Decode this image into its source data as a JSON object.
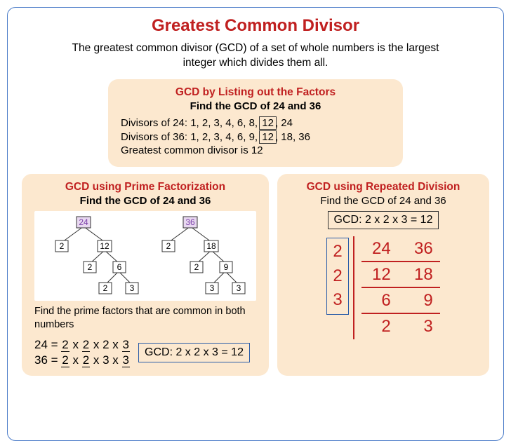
{
  "title": "Greatest Common Divisor",
  "intro": "The greatest common divisor (GCD) of a set of whole numbers is the largest integer which divides them all.",
  "listing": {
    "title": "GCD by Listing out the Factors",
    "subtitle": "Find the GCD of 24 and 36",
    "line1_prefix": "Divisors of 24: 1, 2, 3, 4, 6, 8, ",
    "line1_boxed": "12",
    "line1_suffix": ", 24",
    "line2_prefix": "Divisors of 36: 1, 2, 3, 4, 6, 9, ",
    "line2_boxed": "12",
    "line2_suffix": ", 18, 36",
    "result": "Greatest common divisor is 12"
  },
  "prime": {
    "title": "GCD using Prime Factorization",
    "subtitle": "Find the GCD of 24 and 36",
    "note": "Find the prime factors that are common in both numbers",
    "tree1": {
      "root": "24",
      "nodes": [
        "2",
        "12",
        "2",
        "6",
        "2",
        "3"
      ]
    },
    "tree2": {
      "root": "36",
      "nodes": [
        "2",
        "18",
        "2",
        "9",
        "3",
        "3"
      ]
    },
    "eq1_a": "24 = ",
    "eq1_b": "2",
    "eq1_c": " x ",
    "eq1_d": "2",
    "eq1_e": " x 2 x ",
    "eq1_f": "3",
    "eq2_a": "36 = ",
    "eq2_b": "2",
    "eq2_c": " x ",
    "eq2_d": "2",
    "eq2_e": " x 3 x ",
    "eq2_f": "3",
    "gcd_box": "GCD: 2 x 2 x 3 = 12"
  },
  "repeated": {
    "title": "GCD using Repeated Division",
    "subtitle": "Find the GCD of 24 and 36",
    "gcd_box": "GCD: 2 x 2 x 3 = 12",
    "divisors": [
      "2",
      "2",
      "3"
    ],
    "rows": [
      [
        "24",
        "36"
      ],
      [
        "12",
        "18"
      ],
      [
        "6",
        "9"
      ],
      [
        "2",
        "3"
      ]
    ]
  }
}
